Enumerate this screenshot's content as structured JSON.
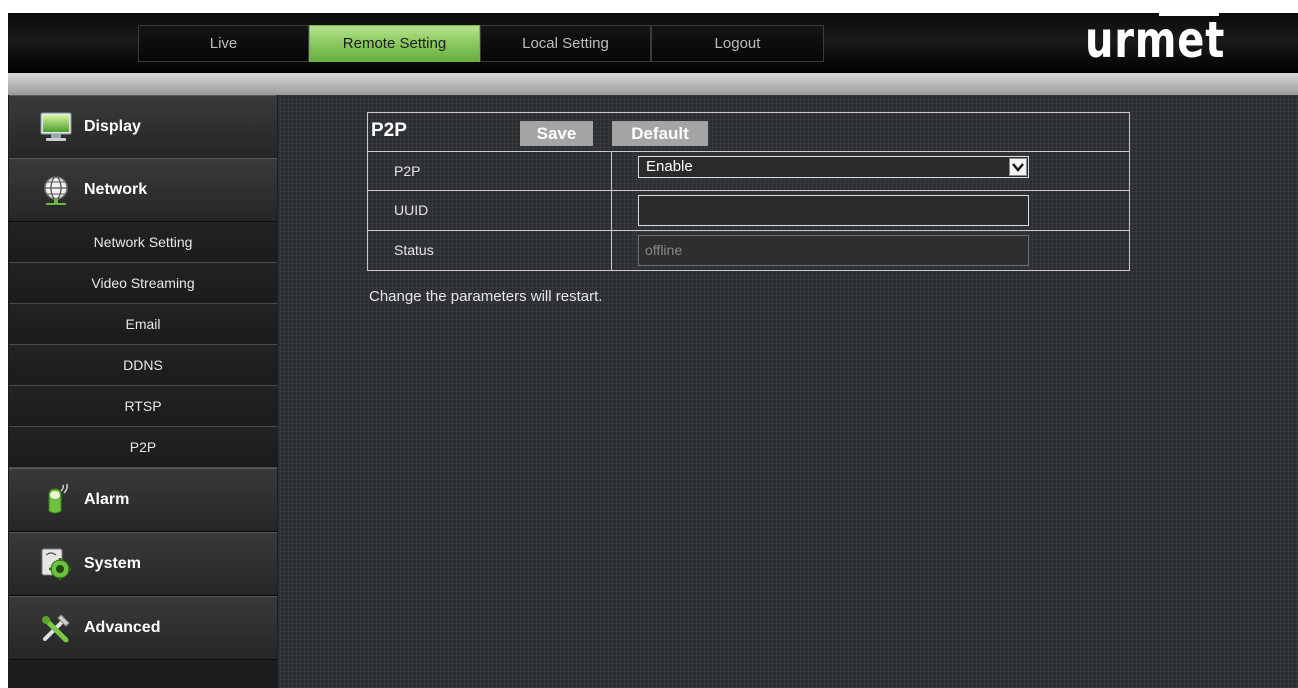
{
  "nav": {
    "tabs": [
      {
        "label": "Live"
      },
      {
        "label": "Remote Setting"
      },
      {
        "label": "Local Setting"
      },
      {
        "label": "Logout"
      }
    ],
    "active_tab": "Remote Setting",
    "active_color": "#86c65b",
    "logo_text": "urmet"
  },
  "sidebar": {
    "sections": [
      {
        "label": "Display",
        "icon": "monitor-icon"
      },
      {
        "label": "Network",
        "icon": "globe-icon"
      },
      {
        "label": "Alarm",
        "icon": "alarm-sensor-icon"
      },
      {
        "label": "System",
        "icon": "system-gear-icon"
      },
      {
        "label": "Advanced",
        "icon": "tools-icon"
      }
    ],
    "network_items": [
      {
        "label": "Network Setting"
      },
      {
        "label": "Video Streaming"
      },
      {
        "label": "Email"
      },
      {
        "label": "DDNS"
      },
      {
        "label": "RTSP"
      },
      {
        "label": "P2P"
      }
    ]
  },
  "panel": {
    "title": "P2P",
    "save_label": "Save",
    "default_label": "Default",
    "rows": [
      {
        "label": "P2P",
        "value": "Enable"
      },
      {
        "label": "UUID",
        "value": ""
      },
      {
        "label": "Status",
        "value": "offline"
      }
    ]
  },
  "note": "Change the parameters will restart."
}
